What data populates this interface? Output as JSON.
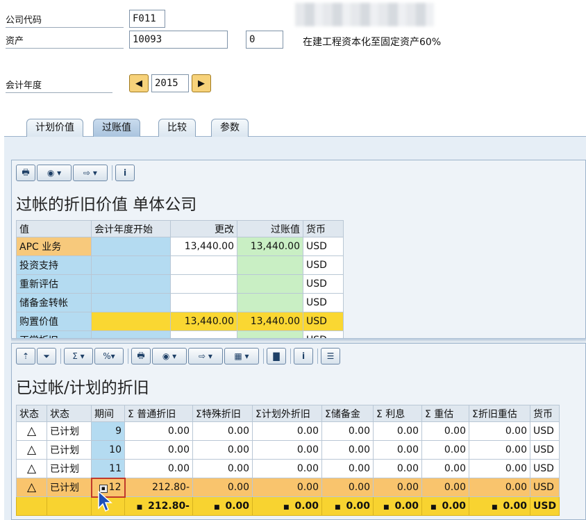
{
  "header": {
    "company_code_label": "公司代码",
    "company_code_value": "F011",
    "asset_label": "资产",
    "asset_value": "10093",
    "sub_number_value": "0",
    "asset_description": "在建工程资本化至固定资产60%",
    "fiscal_year_label": "会计年度",
    "fiscal_year_value": "2015"
  },
  "tabs": [
    {
      "label": "计划价值"
    },
    {
      "label": "过账值"
    },
    {
      "label": "比较"
    },
    {
      "label": "参数"
    }
  ],
  "upper_panel": {
    "title": "过帐的折旧价值 单体公司",
    "columns": [
      "值",
      "会计年度开始",
      "更改",
      "过账值",
      "货币"
    ],
    "rows": [
      {
        "label": "APC 业务",
        "start": "",
        "change": "13,440.00",
        "posted": "13,440.00",
        "currency": "USD"
      },
      {
        "label": "投资支持",
        "start": "",
        "change": "",
        "posted": "",
        "currency": "USD"
      },
      {
        "label": "重新评估",
        "start": "",
        "change": "",
        "posted": "",
        "currency": "USD"
      },
      {
        "label": "储备金转帐",
        "start": "",
        "change": "",
        "posted": "",
        "currency": "USD"
      },
      {
        "label": "购置价值",
        "start": "",
        "change": "13,440.00",
        "posted": "13,440.00",
        "currency": "USD"
      },
      {
        "label": "正常折旧",
        "start": "",
        "change": "",
        "posted": "",
        "currency": "USD"
      }
    ]
  },
  "lower_panel": {
    "title": "已过帐/计划的折旧",
    "columns": [
      "状态",
      "状态",
      "期间",
      "Σ 普通折旧",
      "Σ特殊折旧",
      "Σ计划外折旧",
      "Σ储备金",
      "Σ   利息",
      "Σ   重估",
      "Σ折旧重估",
      "货币"
    ],
    "rows": [
      {
        "status_text": "已计划",
        "period": "9",
        "ordinary": "0.00",
        "special": "0.00",
        "unplanned": "0.00",
        "reserve": "0.00",
        "interest": "0.00",
        "revaluation": "0.00",
        "dep_reval": "0.00",
        "currency": "USD"
      },
      {
        "status_text": "已计划",
        "period": "10",
        "ordinary": "0.00",
        "special": "0.00",
        "unplanned": "0.00",
        "reserve": "0.00",
        "interest": "0.00",
        "revaluation": "0.00",
        "dep_reval": "0.00",
        "currency": "USD"
      },
      {
        "status_text": "已计划",
        "period": "11",
        "ordinary": "0.00",
        "special": "0.00",
        "unplanned": "0.00",
        "reserve": "0.00",
        "interest": "0.00",
        "revaluation": "0.00",
        "dep_reval": "0.00",
        "currency": "USD"
      },
      {
        "status_text": "已计划",
        "period": "12",
        "ordinary": "212.80-",
        "special": "0.00",
        "unplanned": "0.00",
        "reserve": "0.00",
        "interest": "0.00",
        "revaluation": "0.00",
        "dep_reval": "0.00",
        "currency": "USD"
      }
    ],
    "total": {
      "ordinary": "212.80-",
      "special": "0.00",
      "unplanned": "0.00",
      "reserve": "0.00",
      "interest": "0.00",
      "revaluation": "0.00",
      "dep_reval": "0.00",
      "currency": "USD"
    }
  },
  "icons": {
    "warning": "warning-triangle-icon",
    "cursor": "mouse-pointer-icon"
  }
}
